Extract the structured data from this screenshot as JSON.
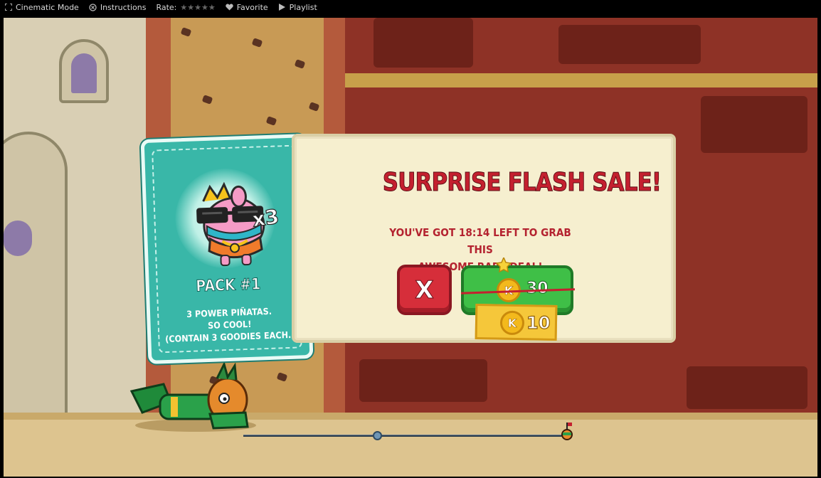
{
  "toolbar": {
    "cinematic_label": "Cinematic Mode",
    "instructions_label": "Instructions",
    "rate_label": "Rate:",
    "stars": "★★★★★",
    "favorite_label": "Favorite",
    "playlist_label": "Playlist",
    "icons": {
      "cinematic": "fullscreen-icon",
      "instructions": "help-icon",
      "favorite": "heart-icon",
      "playlist": "play-icon"
    }
  },
  "sale": {
    "title": "SURPRISE FLASH SALE!",
    "subtitle_line1": "YOU'VE GOT 18:14 LEFT TO GRAB THIS",
    "subtitle_line2": "AWESOME RARE DEAL!",
    "close_label": "X",
    "coin_symbol": "K",
    "old_price": "30",
    "new_price": "10"
  },
  "card": {
    "multiplier": "x3",
    "title": "PACK #1",
    "desc_line1": "3 POWER PIÑATAS.",
    "desc_line2": "SO COOL!",
    "desc_line3": "(CONTAIN 3 GOODIES EACH.)"
  },
  "progress": {
    "fraction": 0.41
  },
  "colors": {
    "accent_red": "#c4202f",
    "buy_green": "#3fbf47",
    "card_teal": "#39b7a8",
    "coin_gold": "#f3b91c"
  }
}
